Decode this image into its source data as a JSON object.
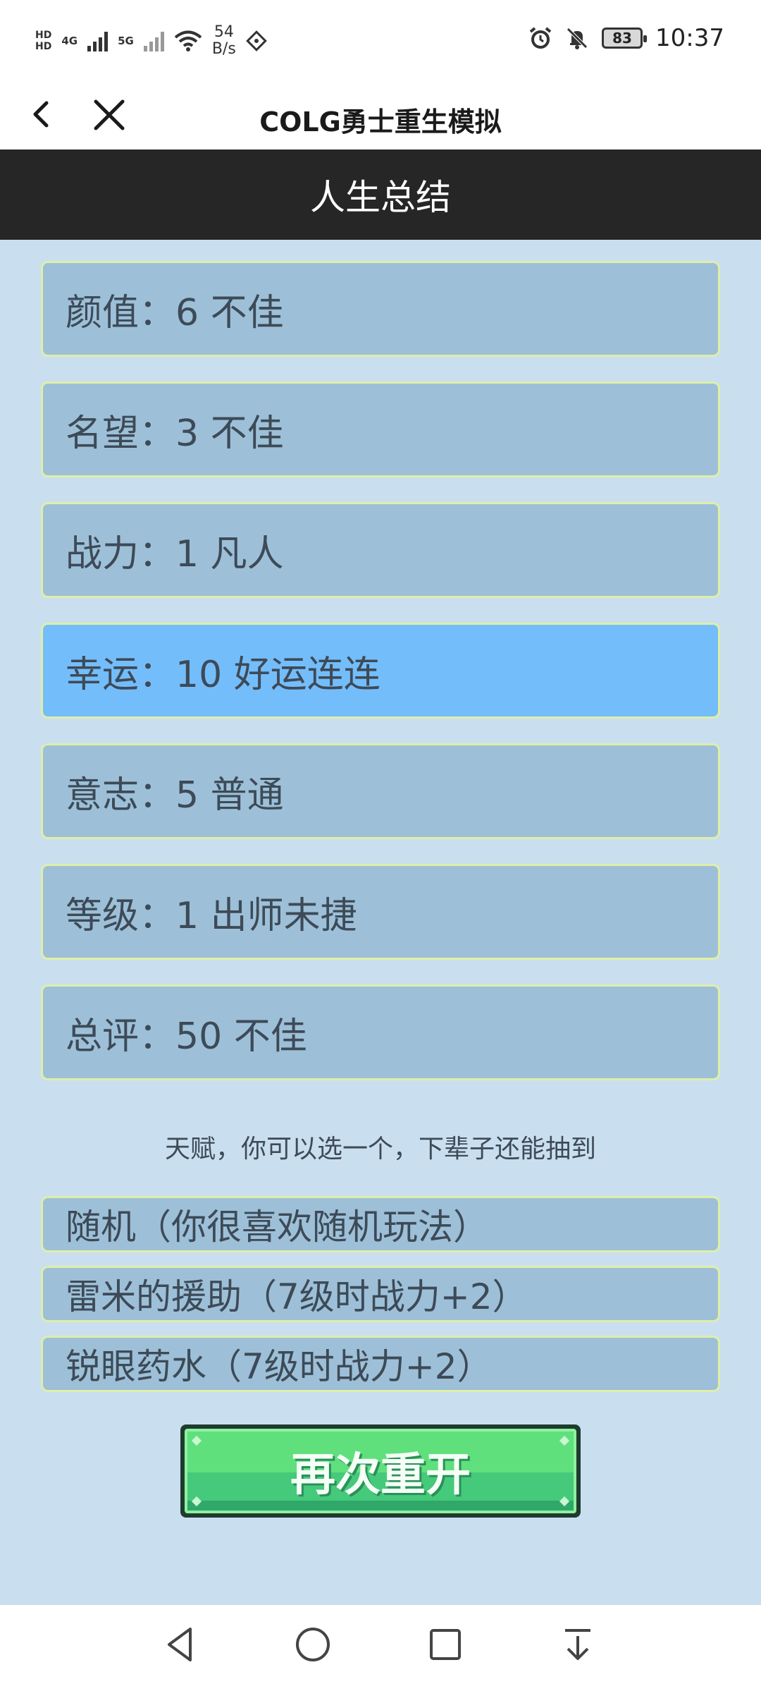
{
  "status_bar": {
    "hd_top": "HD",
    "hd_bottom": "HD",
    "net_4g": "4G",
    "net_5g": "5G",
    "speed_value": "54",
    "speed_unit": "B/s",
    "battery": "83",
    "time": "10:37"
  },
  "nav": {
    "title": "COLG勇士重生模拟"
  },
  "header": {
    "title": "人生总结"
  },
  "stats": [
    {
      "text": "颜值：6 不佳",
      "highlight": false
    },
    {
      "text": "名望：3 不佳",
      "highlight": false
    },
    {
      "text": "战力：1 凡人",
      "highlight": false
    },
    {
      "text": "幸运：10 好运连连",
      "highlight": true
    },
    {
      "text": "意志：5 普通",
      "highlight": false
    },
    {
      "text": "等级：1 出师未捷",
      "highlight": false
    },
    {
      "text": "总评：50 不佳",
      "highlight": false
    }
  ],
  "hint": "天赋，你可以选一个，下辈子还能抽到",
  "talents": [
    "随机（你很喜欢随机玩法）",
    "雷米的援助（7级时战力+2）",
    "锐眼药水（7级时战力+2）"
  ],
  "restart_label": "再次重开",
  "colors": {
    "background": "#c9dff0",
    "card": "#9dc0d8",
    "card_highlight": "#74bdfb",
    "card_border": "#dfeea8",
    "header_bg": "#262626",
    "button_green": "#5fe07d"
  },
  "icons": {
    "back": "chevron-left-icon",
    "close": "close-icon",
    "nav_back": "triangle-back-icon",
    "nav_home": "circle-home-icon",
    "nav_recent": "square-recent-icon",
    "nav_down": "download-arrow-icon"
  }
}
